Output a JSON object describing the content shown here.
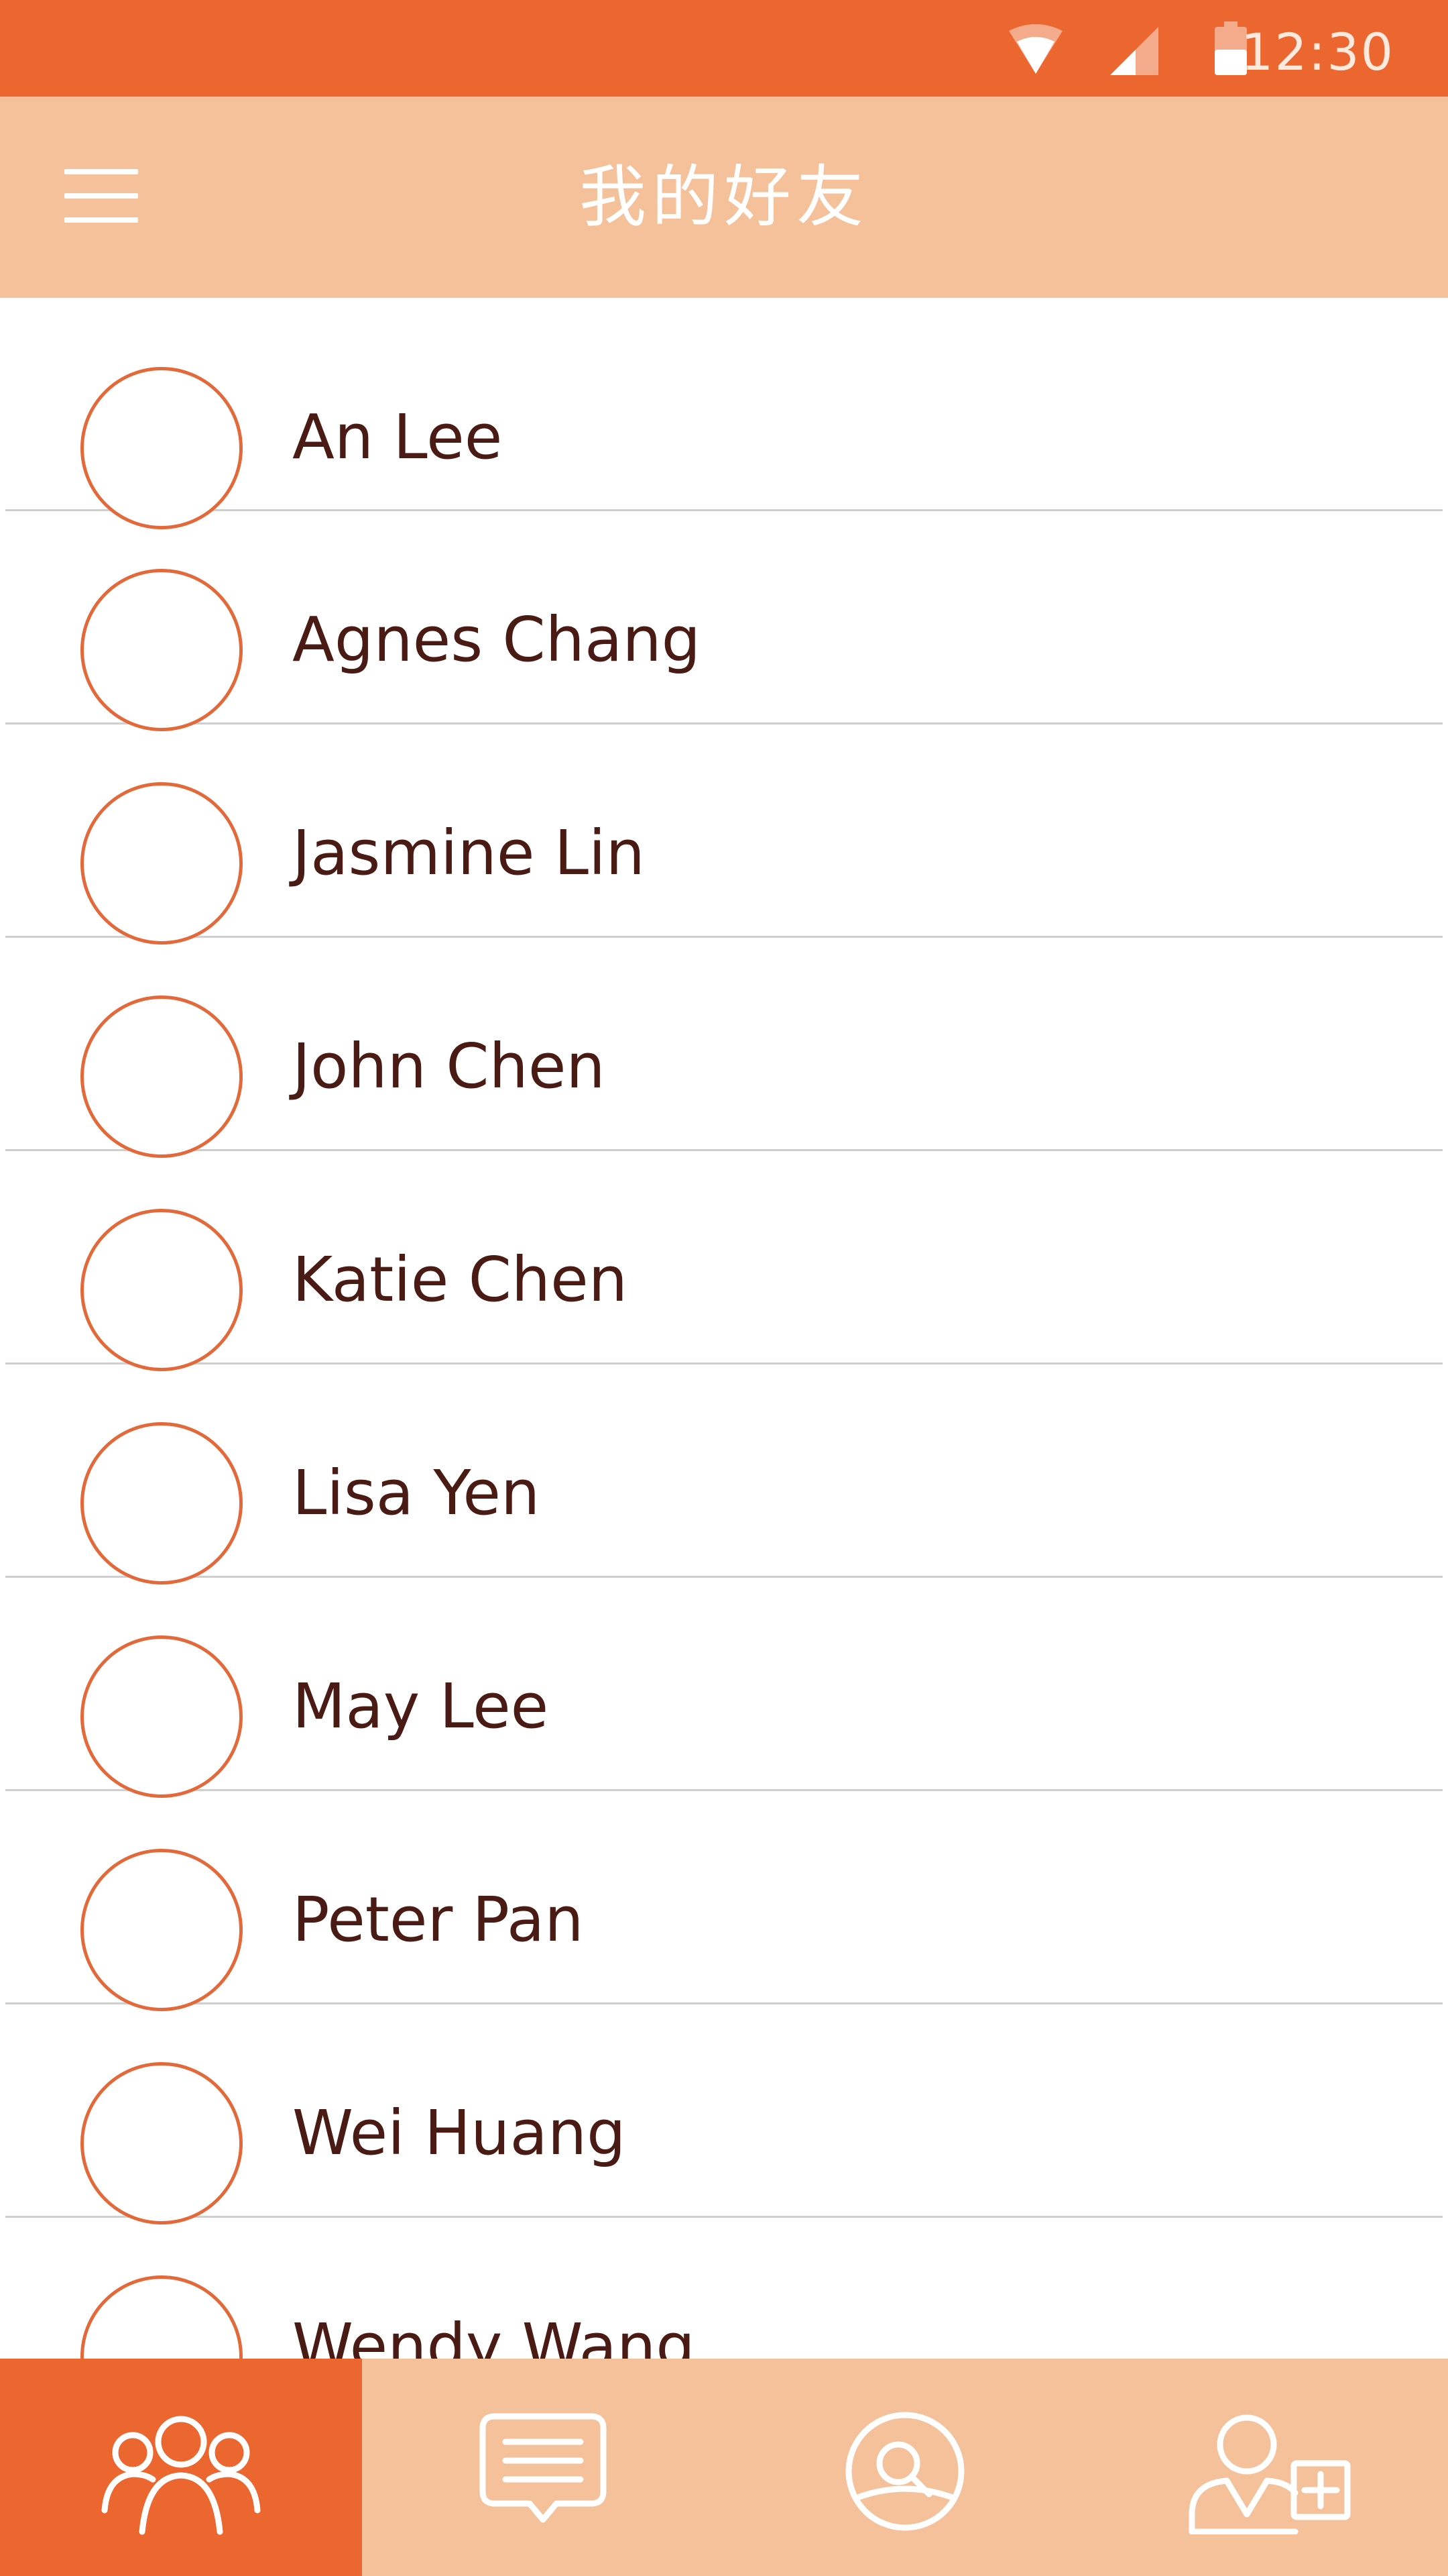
{
  "status_bar": {
    "time": "12:30",
    "icons": [
      "wifi-icon",
      "signal-icon",
      "battery-icon"
    ]
  },
  "header": {
    "title": "我的好友",
    "menu_icon": "hamburger-menu-icon"
  },
  "friends": [
    {
      "name": "An Lee"
    },
    {
      "name": "Agnes Chang"
    },
    {
      "name": "Jasmine Lin"
    },
    {
      "name": "John Chen"
    },
    {
      "name": "Katie Chen"
    },
    {
      "name": "Lisa Yen"
    },
    {
      "name": "May Lee"
    },
    {
      "name": "Peter Pan"
    },
    {
      "name": "Wei Huang"
    },
    {
      "name": "Wendy Wang"
    }
  ],
  "bottom_nav": {
    "tabs": [
      {
        "icon": "friends-group-icon",
        "active": true
      },
      {
        "icon": "chat-message-icon",
        "active": false
      },
      {
        "icon": "search-icon",
        "active": false
      },
      {
        "icon": "add-friend-icon",
        "active": false
      }
    ]
  },
  "colors": {
    "primary": "#ec662f",
    "secondary": "#f4c19b",
    "text": "#4a1a14",
    "divider": "#cfcfcf"
  }
}
